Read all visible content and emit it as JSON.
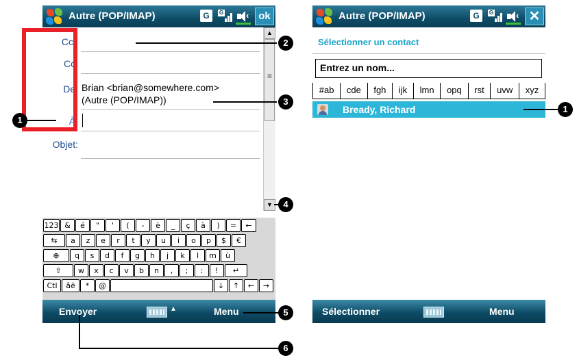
{
  "left_screen": {
    "title": "Autre (POP/IMAP)",
    "status_g": "G",
    "status_sig_letter": "G",
    "ok_label": "ok",
    "fields": {
      "cci_label": "Cci:",
      "cc_label": "Cc:",
      "de_label": "De:",
      "de_value_line1": "Brian <brian@somewhere.com>",
      "de_value_line2": "(Autre (POP/IMAP))",
      "a_label": "À:",
      "objet_label": "Objet:"
    },
    "keyboard": {
      "row1": [
        "123",
        "&",
        "é",
        "\"",
        "'",
        "(",
        "-",
        "è",
        "_",
        "ç",
        "à",
        ")",
        "=",
        "←"
      ],
      "row2": [
        "⇆",
        "a",
        "z",
        "e",
        "r",
        "t",
        "y",
        "u",
        "i",
        "o",
        "p",
        "$",
        "€"
      ],
      "row3": [
        "⊕",
        "q",
        "s",
        "d",
        "f",
        "g",
        "h",
        "j",
        "k",
        "l",
        "m",
        "ù"
      ],
      "row4": [
        "⇧",
        "w",
        "x",
        "c",
        "v",
        "b",
        "n",
        ",",
        ";",
        ":",
        "!",
        "↵"
      ],
      "row5": [
        "Ctl",
        "âë",
        "*",
        "@",
        " ",
        "↓",
        "↑",
        "←",
        "→"
      ]
    },
    "menubar": {
      "left": "Envoyer",
      "right": "Menu",
      "kbd_arrow": "▲"
    }
  },
  "right_screen": {
    "title": "Autre (POP/IMAP)",
    "status_g": "G",
    "status_sig_letter": "G",
    "close_label": "✕",
    "header": "Sélectionner un contact",
    "name_input_value": "Entrez un nom...",
    "alpha_tabs": [
      "#ab",
      "cde",
      "fgh",
      "ijk",
      "lmn",
      "opq",
      "rst",
      "uvw",
      "xyz"
    ],
    "contact": "Bready, Richard",
    "menubar": {
      "left": "Sélectionner",
      "right": "Menu"
    }
  },
  "callouts": {
    "one_left": "1",
    "two": "2",
    "three": "3",
    "four": "4",
    "five": "5",
    "six": "6",
    "one_right": "1"
  },
  "colors": {
    "title_bar": "#0e4c66",
    "accent": "#2cb6d7",
    "highlight_box": "#ea2027"
  }
}
